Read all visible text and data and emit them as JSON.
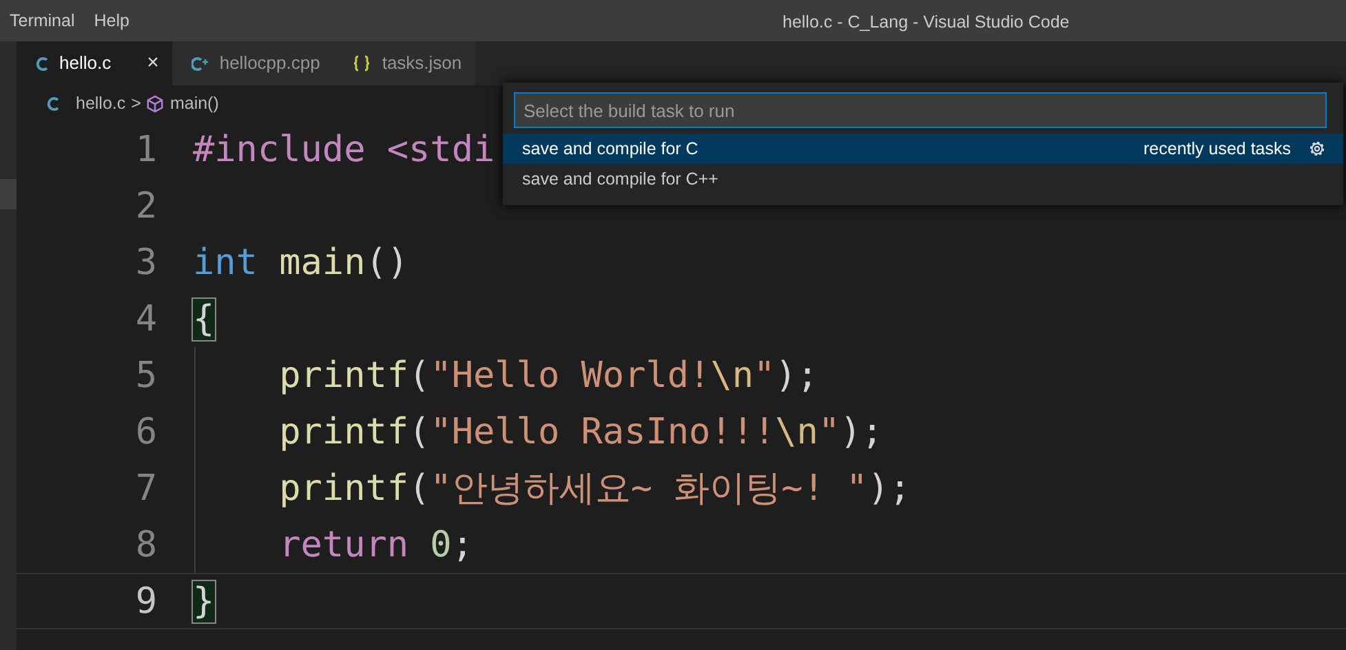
{
  "menu": [
    "Terminal",
    "Help"
  ],
  "window": {
    "title": "hello.c - C_Lang - Visual Studio Code"
  },
  "tabs": [
    {
      "label": "hello.c",
      "kind": "c",
      "selected": true,
      "close": "×"
    },
    {
      "label": "hellocpp.cpp",
      "kind": "cpp",
      "selected": false
    },
    {
      "label": "tasks.json",
      "kind": "json",
      "selected": false
    }
  ],
  "breadcrumb": {
    "file": "hello.c",
    "separator": ">",
    "symbol": "main()"
  },
  "editor": {
    "lines": [
      {
        "number": "1",
        "current": false,
        "indented": false,
        "tokens": [
          {
            "kind": "directive",
            "text": "#include <stdi"
          }
        ]
      },
      {
        "number": "2",
        "current": false,
        "indented": false
      },
      {
        "number": "3",
        "current": false,
        "indented": false,
        "tokens": [
          {
            "kind": "keyword",
            "text": "int"
          },
          {
            "kind": "function",
            "text": "main"
          },
          {
            "kind": "plain",
            "text": "()"
          }
        ]
      },
      {
        "number": "4",
        "current": false,
        "indented": false,
        "tokens": [
          {
            "kind": "bracket-match",
            "text": "{"
          }
        ]
      },
      {
        "number": "5",
        "current": false,
        "indented": true,
        "tokens": [
          {
            "kind": "function",
            "text": "printf"
          },
          {
            "kind": "plain",
            "text": "("
          },
          {
            "kind": "string",
            "text": "\"Hello World!"
          },
          {
            "kind": "escape",
            "text": "\\n"
          },
          {
            "kind": "string",
            "text": "\""
          },
          {
            "kind": "plain",
            "text": ");"
          }
        ]
      },
      {
        "number": "6",
        "current": false,
        "indented": true,
        "tokens": [
          {
            "kind": "function",
            "text": "printf"
          },
          {
            "kind": "plain",
            "text": "("
          },
          {
            "kind": "string",
            "text": "\"Hello RasIno!!!"
          },
          {
            "kind": "escape",
            "text": "\\n"
          },
          {
            "kind": "string",
            "text": "\""
          },
          {
            "kind": "plain",
            "text": ");"
          }
        ]
      },
      {
        "number": "7",
        "current": false,
        "indented": true,
        "tokens": [
          {
            "kind": "function",
            "text": "printf"
          },
          {
            "kind": "plain",
            "text": "("
          },
          {
            "kind": "string",
            "text": "\"안녕하세요~ 화이팅~! \""
          },
          {
            "kind": "plain",
            "text": ");"
          }
        ]
      },
      {
        "number": "8",
        "current": false,
        "indented": true,
        "tokens": [
          {
            "kind": "control",
            "text": "return"
          },
          {
            "kind": "number",
            "text": "0"
          },
          {
            "kind": "plain",
            "text": ";"
          }
        ]
      },
      {
        "number": "9",
        "current": true,
        "indented": false,
        "tokens": [
          {
            "kind": "bracket-match",
            "text": "}"
          }
        ]
      }
    ]
  },
  "quick_pick": {
    "placeholder": "Select the build task to run",
    "items": [
      {
        "label": "save and compile for C",
        "selected": true,
        "detail": "recently used tasks"
      },
      {
        "label": "save and compile for C++",
        "selected": false
      }
    ]
  }
}
